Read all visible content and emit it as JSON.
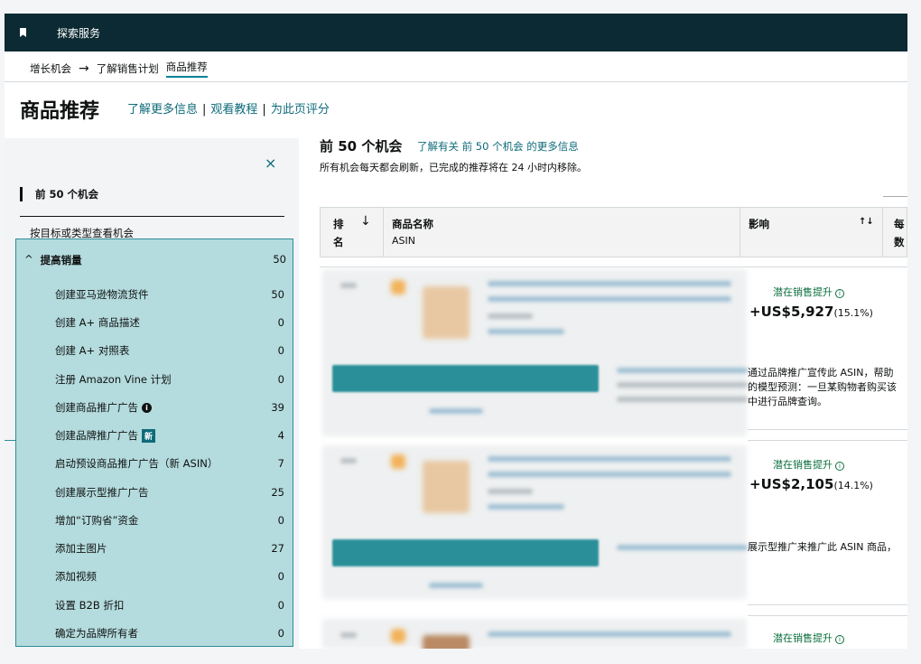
{
  "topbar": {
    "title": "探索服务"
  },
  "breadcrumb": {
    "item1": "增长机会",
    "arrow": "→",
    "item2": "了解销售计划",
    "item3": "商品推荐"
  },
  "page": {
    "title": "商品推荐",
    "link_learn": "了解更多信息",
    "link_tutorial": "观看教程",
    "link_rate": "为此页评分",
    "sep": "|"
  },
  "sidebar": {
    "close": "×",
    "top50": "前 50 个机会",
    "by_type": "按目标或类型查看机会",
    "category": {
      "chevron": "^",
      "label": "提高销量",
      "count": "50"
    },
    "items": [
      {
        "label": "创建亚马逊物流货件",
        "count": "50"
      },
      {
        "label": "创建 A+ 商品描述",
        "count": "0"
      },
      {
        "label": "创建 A+ 对照表",
        "count": "0"
      },
      {
        "label": "注册 Amazon Vine 计划",
        "count": "0"
      },
      {
        "label": "创建商品推广广告",
        "count": "39",
        "info": "i"
      },
      {
        "label": "创建品牌推广广告",
        "count": "4",
        "badge": "新"
      },
      {
        "label": "启动预设商品推广广告（新 ASIN）",
        "count": "7"
      },
      {
        "label": "创建展示型推广广告",
        "count": "25"
      },
      {
        "label": "增加“订购省”资金",
        "count": "0"
      },
      {
        "label": "添加主图片",
        "count": "27"
      },
      {
        "label": "添加视频",
        "count": "0"
      },
      {
        "label": "设置 B2B 折扣",
        "count": "0"
      },
      {
        "label": "确定为品牌所有者",
        "count": "0"
      }
    ]
  },
  "main": {
    "title": "前 50 个机会",
    "link": "了解有关 前 50 个机会 的更多信息",
    "subtitle": "所有机会每天都会刷新，已完成的推荐将在 24 小时内移除。",
    "table": {
      "col_rank_1": "排",
      "col_rank_2": "名",
      "sort_arrow": "↓",
      "col_product": "商品名称",
      "col_asin": "ASIN",
      "col_impact": "影响",
      "sort_icon": "↑↓",
      "col_next_1": "每",
      "col_next_2": "数"
    },
    "rows": [
      {
        "badge": "潜在销售提升",
        "value": "+US$5,927",
        "pct": "(15.1%)",
        "desc1": "通过品牌推广宣传此 ASIN，帮助",
        "desc2": "的模型预测：一旦某购物者购买该",
        "desc3": "中进行品牌查询。"
      },
      {
        "badge": "潜在销售提升",
        "value": "+US$2,105",
        "pct": "(14.1%)",
        "desc1": "展示型推广来推广此 ASIN 商品，"
      },
      {
        "badge": "潜在销售提升"
      }
    ]
  }
}
